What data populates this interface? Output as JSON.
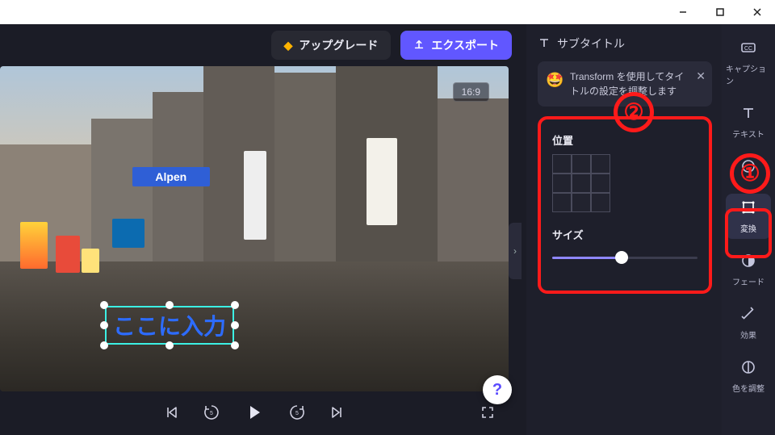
{
  "window": {
    "minimize": "–",
    "maximize": "□",
    "close": "✕"
  },
  "topbar": {
    "upgrade_label": "アップグレード",
    "export_label": "エクスポート"
  },
  "preview": {
    "aspect_label": "16:9",
    "text_overlay_value": "ここに入力",
    "building_sign": "Alpen"
  },
  "controls": {
    "help_glyph": "?"
  },
  "inspector": {
    "header_label": "サブタイトル",
    "tip_text": "Transform を使用してタイトルの設定を調整します",
    "position_label": "位置",
    "size_label": "サイズ",
    "size_value_pct": 48
  },
  "toolbar": {
    "items": [
      {
        "key": "caption",
        "label": "キャプション"
      },
      {
        "key": "text",
        "label": "テキスト"
      },
      {
        "key": "crop",
        "label": ""
      },
      {
        "key": "transform",
        "label": "変換"
      },
      {
        "key": "fade",
        "label": "フェード"
      },
      {
        "key": "effects",
        "label": "効果"
      },
      {
        "key": "color",
        "label": "色を調整"
      }
    ]
  },
  "annotations": {
    "one": "①",
    "two": "②"
  }
}
